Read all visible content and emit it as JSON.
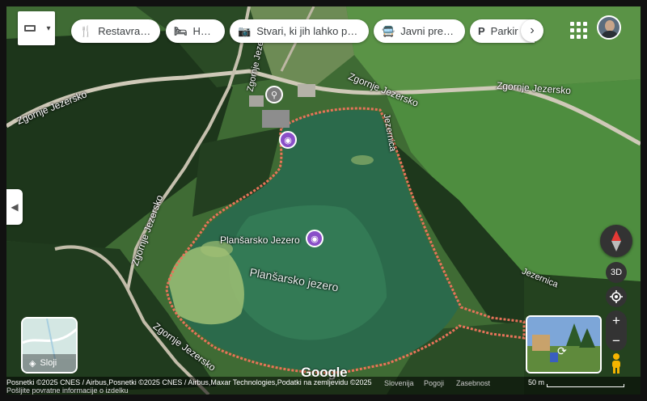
{
  "toolbar": {
    "chips": [
      {
        "icon": "fork-knife-icon",
        "glyph": "🍴",
        "label": "Restavracije"
      },
      {
        "icon": "bed-icon",
        "glyph": "🛏",
        "label": "Hoteli"
      },
      {
        "icon": "camera-icon",
        "glyph": "📷",
        "label": "Stvari, ki jih lahko po..."
      },
      {
        "icon": "bus-icon",
        "glyph": "🚍",
        "label": "Javni prevoz"
      },
      {
        "icon": "parking-icon",
        "glyph": "P",
        "label": "Parkir"
      }
    ]
  },
  "map": {
    "roads": [
      "Zgornje Jezersko",
      "Zgornje Jezersko",
      "Zgornje Jezersko",
      "Zgornje Jezersko",
      "Zgornje Jezersko"
    ],
    "streams": [
      "Jezernica",
      "Jezernica"
    ],
    "lake_label": "Planšarsko jezero",
    "poi_label": "Planšarsko Jezero"
  },
  "controls": {
    "btn_3d": "3D",
    "layers_label": "Sloji",
    "google_logo": "Google"
  },
  "footer": {
    "attribution": "Posnetki ©2025 CNES / Airbus,Posnetki ©2025 CNES / Airbus,Maxar Technologies,Podatki na zemljevidu ©2025",
    "feedback": "Pošljite povratne informacije o izdelku",
    "country": "Slovenija",
    "terms": "Pogoji",
    "privacy": "Zasebnost",
    "scale": "50 m"
  },
  "colors": {
    "trail": "#e8735a",
    "lake": "#2e6a4c",
    "meadow": "#4f8a3f",
    "forest": "#1f3b1c",
    "road": "#c9c4b6",
    "poi_purple": "#8a4fc8",
    "poi_grey": "#7c7c7c"
  }
}
